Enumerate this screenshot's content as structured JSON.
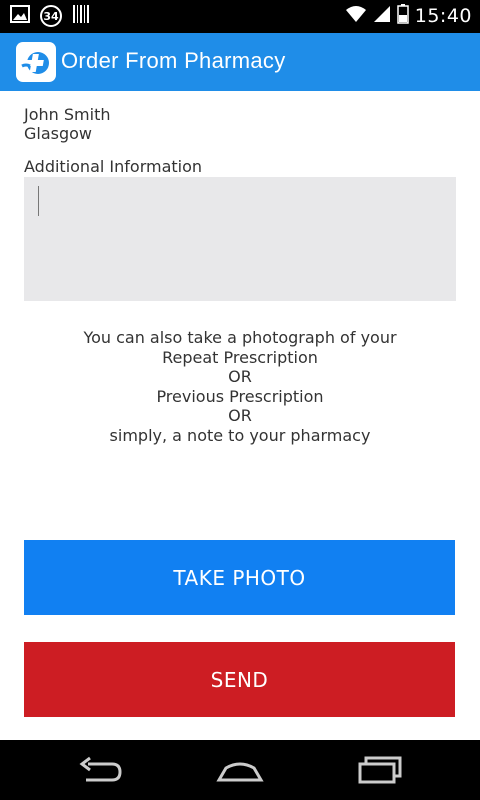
{
  "status_bar": {
    "notification_count": "34",
    "time": "15:40"
  },
  "app_bar": {
    "title": "Order From Pharmacy"
  },
  "form": {
    "name": "John Smith",
    "city": "Glasgow",
    "additional_info_label": "Additional Information",
    "additional_info_value": ""
  },
  "photo_hint": {
    "line1": "You can also take a photograph of your",
    "line2": "Repeat Prescription",
    "line3": "OR",
    "line4": "Previous Prescription",
    "line5": "OR",
    "line6": "simply, a note to your pharmacy"
  },
  "buttons": {
    "take_photo": "TAKE PHOTO",
    "send": "SEND"
  },
  "colors": {
    "app_bar": "#1f8de8",
    "take_photo": "#1180f2",
    "send": "#cd1d23"
  }
}
